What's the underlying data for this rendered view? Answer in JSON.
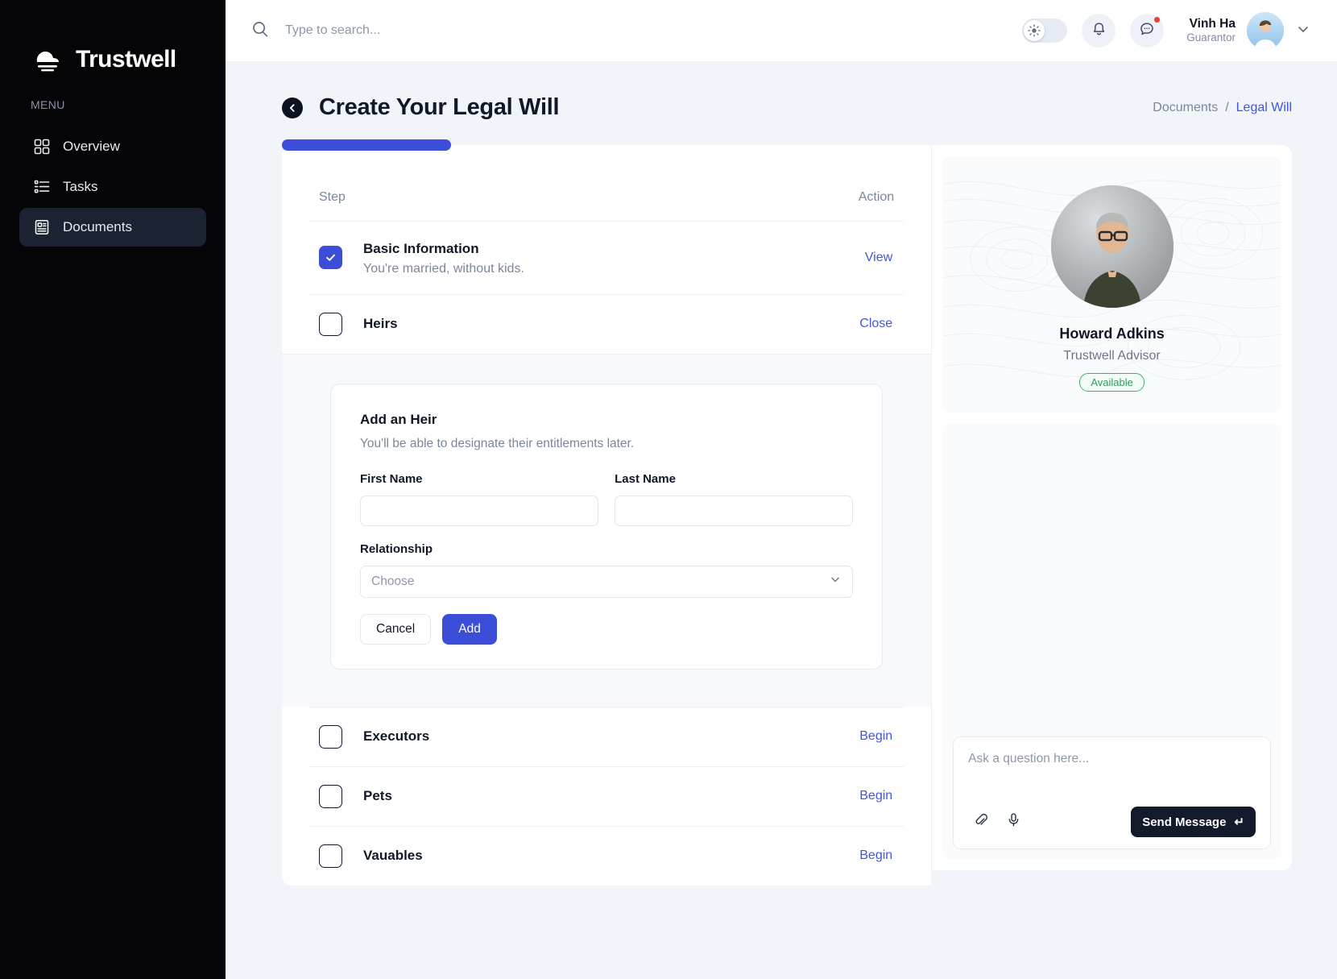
{
  "brand": {
    "name": "Trustwell",
    "logo_icon": "cloud-sun-logo"
  },
  "sidebar": {
    "menu_label": "MENU",
    "items": [
      {
        "label": "Overview",
        "icon": "grid-icon",
        "active": false
      },
      {
        "label": "Tasks",
        "icon": "list-icon",
        "active": false
      },
      {
        "label": "Documents",
        "icon": "document-icon",
        "active": true
      }
    ]
  },
  "topbar": {
    "search_placeholder": "Type to search...",
    "search_value": "",
    "search_icon": "search-icon",
    "theme_toggle_icon": "sun-icon",
    "notification_icon": "bell-icon",
    "messages_icon": "chat-bubble-icon",
    "has_message_badge": true,
    "user": {
      "name": "Vinh Ha",
      "role": "Guarantor"
    },
    "chevron_icon": "chevron-down-icon"
  },
  "page": {
    "title": "Create Your Legal Will",
    "back_icon": "back-arrow-icon",
    "breadcrumb": {
      "parent": "Documents",
      "separator": "/",
      "current": "Legal Will"
    }
  },
  "steps_panel": {
    "progress_percent": 26,
    "columns": {
      "step": "Step",
      "action": "Action"
    },
    "rows": [
      {
        "label": "Basic Information",
        "sublabel": "You're married, without kids.",
        "action": "View",
        "checked": true
      },
      {
        "label": "Heirs",
        "sublabel": "",
        "action": "Close",
        "checked": false
      },
      {
        "label": "Executors",
        "sublabel": "",
        "action": "Begin",
        "checked": false
      },
      {
        "label": "Pets",
        "sublabel": "",
        "action": "Begin",
        "checked": false
      },
      {
        "label": "Vauables",
        "sublabel": "",
        "action": "Begin",
        "checked": false
      }
    ]
  },
  "heir_form": {
    "title": "Add an Heir",
    "subtitle": "You'll be able to designate their entitlements later.",
    "first_name_label": "First Name",
    "first_name_value": "",
    "last_name_label": "Last Name",
    "last_name_value": "",
    "relationship_label": "Relationship",
    "relationship_value": "Choose",
    "cancel_label": "Cancel",
    "add_label": "Add"
  },
  "advisor": {
    "name": "Howard Adkins",
    "role": "Trustwell Advisor",
    "status": "Available",
    "status_color": "#2f9d5e"
  },
  "chat": {
    "placeholder": "Ask a question here...",
    "value": "",
    "attach_icon": "paperclip-icon",
    "mic_icon": "microphone-icon",
    "send_label": "Send Message",
    "send_glyph": "↵"
  },
  "colors": {
    "accent": "#3c4ed8",
    "link": "#4054e8",
    "sidebar_bg": "#050508",
    "page_bg": "#f1f4f9"
  }
}
